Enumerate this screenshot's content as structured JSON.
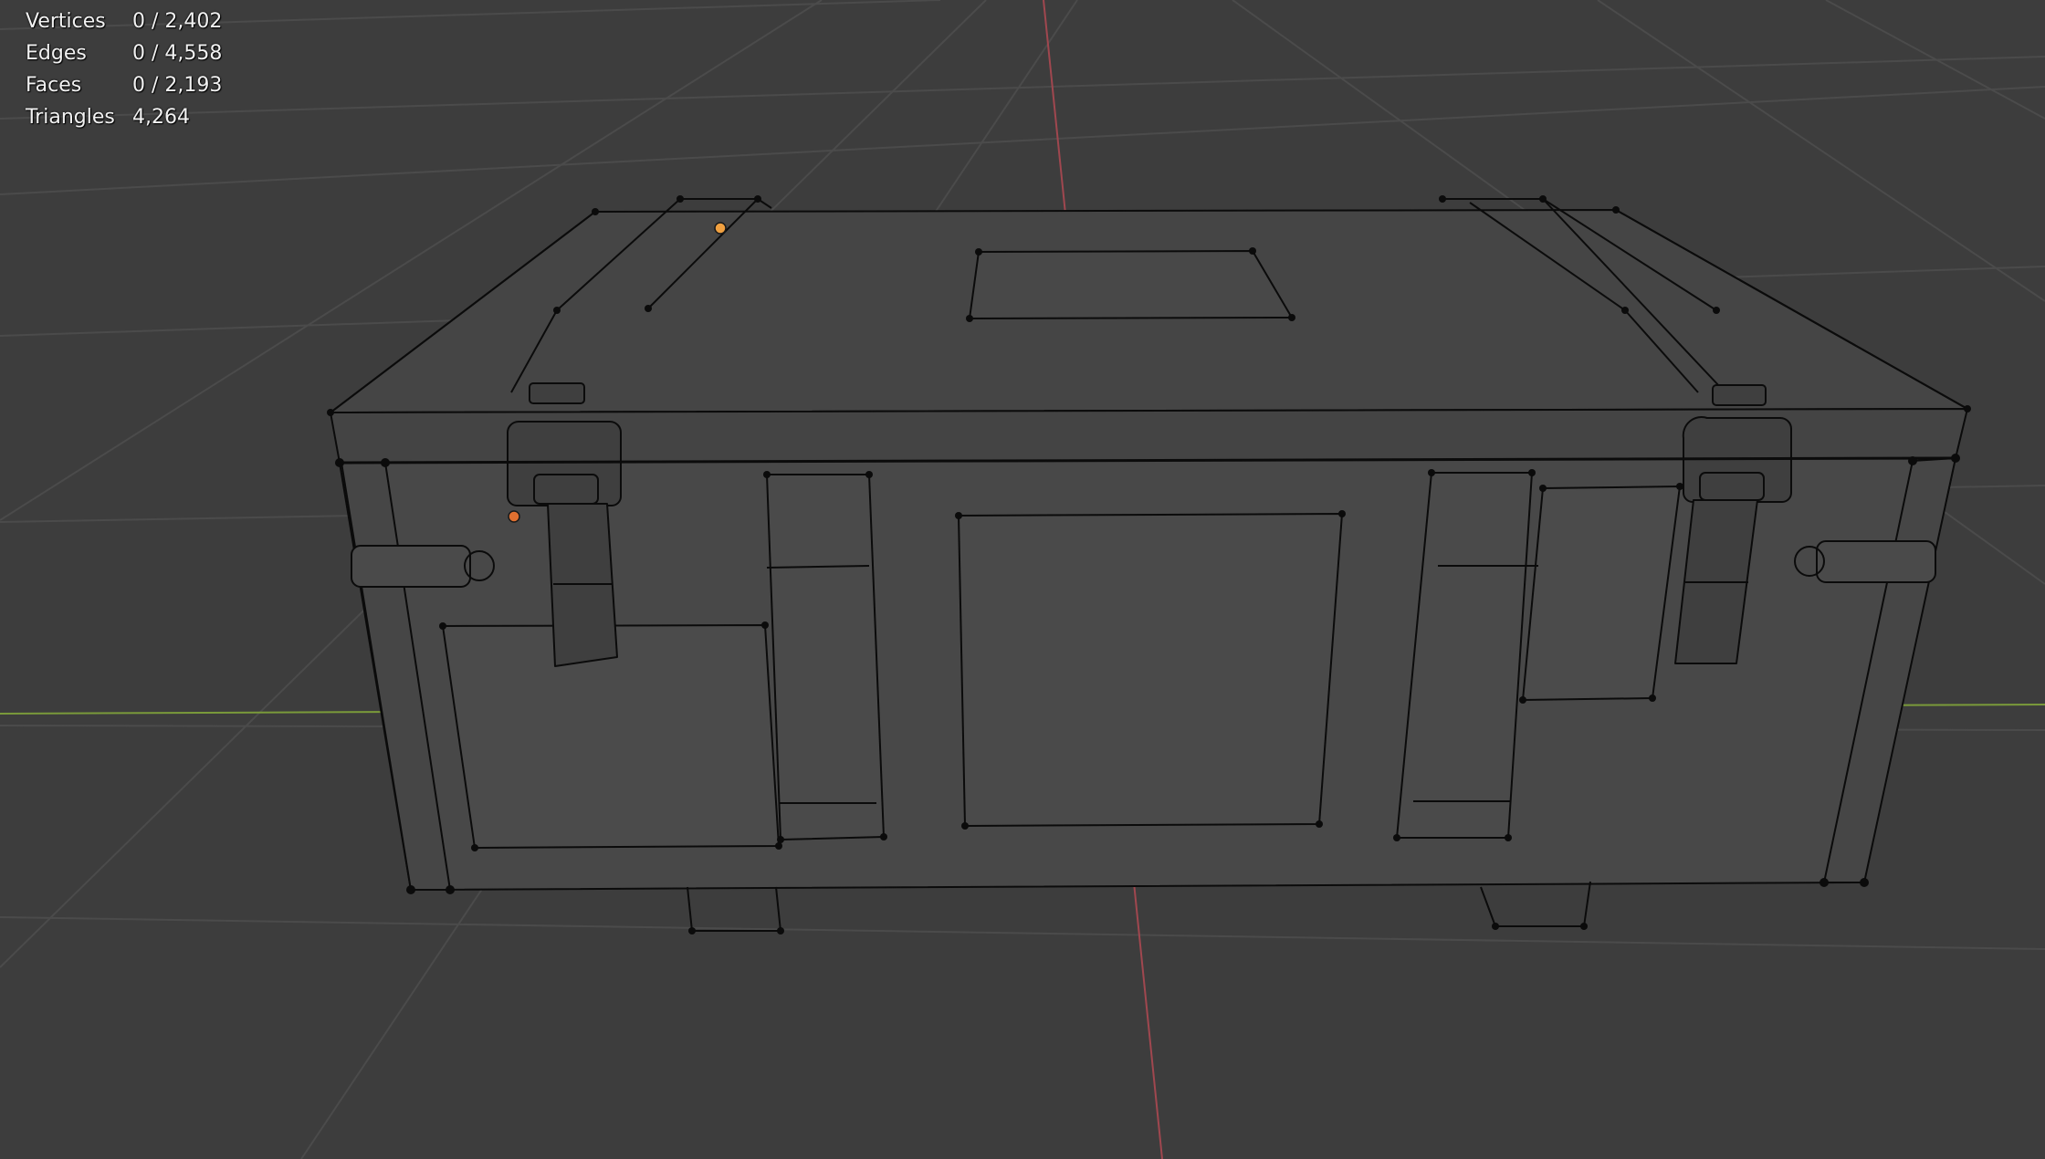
{
  "overlay": {
    "stats": [
      {
        "label": "Vertices",
        "value": "0 / 2,402"
      },
      {
        "label": "Edges",
        "value": "0 / 4,558"
      },
      {
        "label": "Faces",
        "value": "0 / 2,193"
      },
      {
        "label": "Triangles",
        "value": "4,264"
      }
    ]
  },
  "viewport": {
    "background": "#3d3d3d",
    "grid_color": "#4a4a4a",
    "x_axis_color": "#a0474f",
    "y_axis_color": "#7a9a3a",
    "mesh_fill": "#464646",
    "wire_color": "#0b0b0b",
    "selected_vertex_colors": [
      "#f0a040",
      "#e07030"
    ],
    "object_type": "crate mesh in edit mode"
  }
}
